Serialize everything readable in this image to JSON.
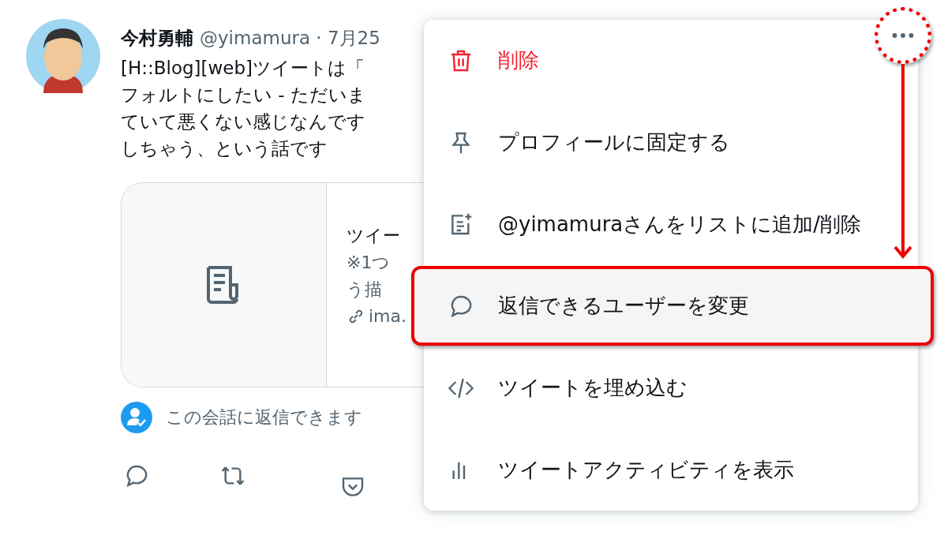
{
  "tweet": {
    "author": "今村勇輔",
    "handle_date": "@yimamura · 7月25",
    "text_lines": [
      "[H::Blog][web]ツイートは「",
      "フォルトにしたい - ただいま",
      "ていて悪くない感じなんです",
      "しちゃう、という話です"
    ],
    "card": {
      "title": "ツイー",
      "lines": [
        "※1つ",
        "う描"
      ],
      "link": "ima."
    },
    "reply_notice": "この会話に返信できます"
  },
  "menu": {
    "items": [
      {
        "kind": "delete",
        "label": "削除",
        "selected": false
      },
      {
        "kind": "pin",
        "label": "プロフィールに固定する",
        "selected": false
      },
      {
        "kind": "list",
        "label": "@yimamuraさんをリストに追加/削除",
        "selected": false
      },
      {
        "kind": "reply",
        "label": "返信できるユーザーを変更",
        "selected": true
      },
      {
        "kind": "embed",
        "label": "ツイートを埋め込む",
        "selected": false
      },
      {
        "kind": "activity",
        "label": "ツイートアクティビティを表示",
        "selected": false
      }
    ]
  }
}
